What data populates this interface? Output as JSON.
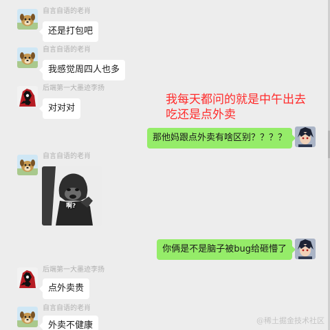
{
  "messages": [
    {
      "sender": "自言自语的老肖",
      "text": "还是打包吧"
    },
    {
      "sender": "自言自语的老肖",
      "text": "我感觉周四人也多"
    },
    {
      "sender": "后端第一大墨迹李扬",
      "text": "对对对"
    },
    {
      "text": "那他妈跟点外卖有啥区别？？？？"
    },
    {
      "sender": "自言自语的老肖",
      "image_caption": "啊?"
    },
    {
      "text": "你俩是不是脑子被bug给砸懵了"
    },
    {
      "sender": "后端第一大墨迹李扬",
      "text": "点外卖贵"
    },
    {
      "sender": "自言自语的老肖",
      "text": "外卖不健康"
    }
  ],
  "annotation": {
    "line1": "我每天都问的就是中午出去",
    "line2": "吃还是点外卖"
  },
  "watermark": "@稀土掘金技术社区",
  "colors": {
    "background": "#ededed",
    "bubble_left": "#ffffff",
    "bubble_right": "#95ec69",
    "annotation": "#ff2a2a",
    "sender_name": "#b0b0b0"
  },
  "icons": {
    "dog_avatar": "dog-avatar-icon",
    "ninja_avatar": "ninja-avatar-icon",
    "self_avatar": "anime-avatar-icon",
    "meme": "monkey-meme"
  }
}
